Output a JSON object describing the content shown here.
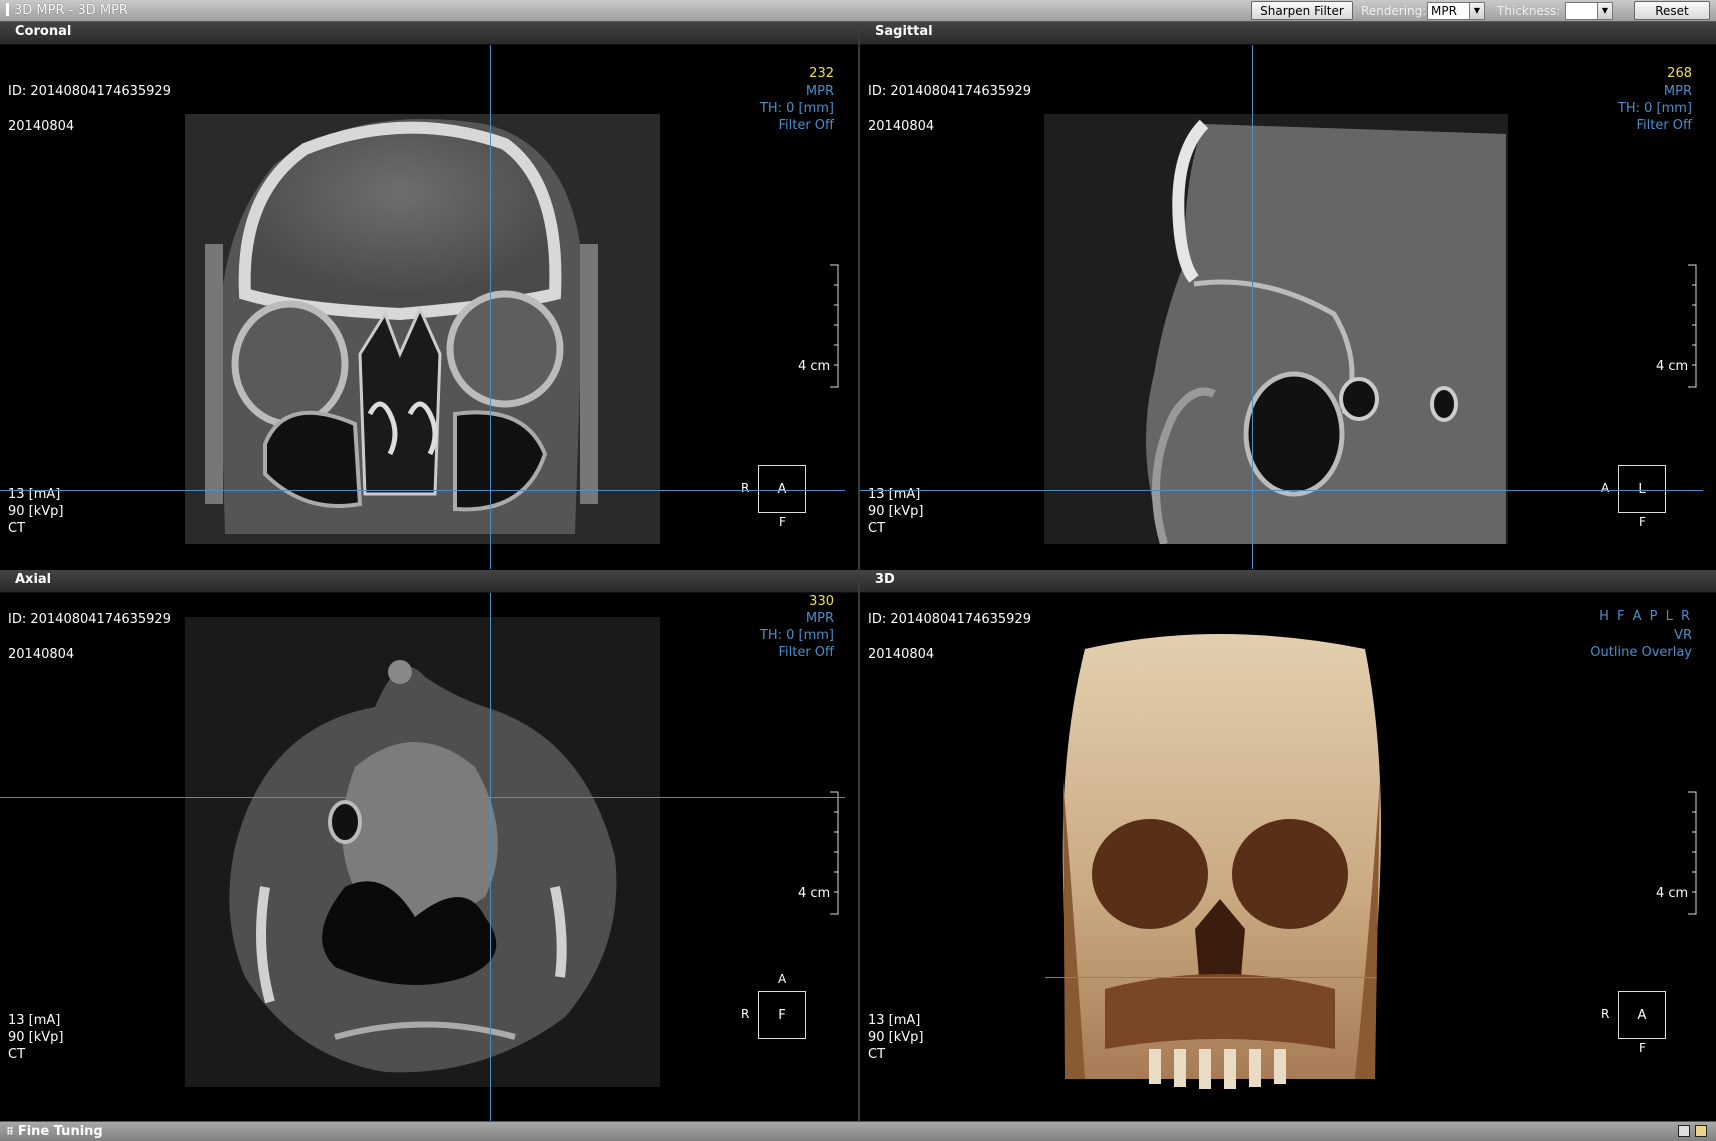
{
  "app": {
    "title": "3D MPR - 3D MPR"
  },
  "toolbar": {
    "sharpen_label": "Sharpen Filter",
    "rendering_label": "Rendering:",
    "rendering_value": "MPR",
    "thickness_label": "Thickness:",
    "thickness_value": "",
    "reset_label": "Reset"
  },
  "viewports": {
    "coronal": {
      "title": "Coronal",
      "slice": "232",
      "id": "ID: 20140804174635929",
      "date": "20140804",
      "mode": "MPR",
      "thickness": "TH: 0 [mm]",
      "filter": "Filter Off",
      "ruler_label": "4 cm",
      "ma": "13 [mA]",
      "kvp": "90 [kVp]",
      "modality": "CT",
      "orient_box": "A",
      "orient_left": "R",
      "orient_bottom": "F"
    },
    "sagittal": {
      "title": "Sagittal",
      "slice": "268",
      "id": "ID: 20140804174635929",
      "date": "20140804",
      "mode": "MPR",
      "thickness": "TH: 0 [mm]",
      "filter": "Filter Off",
      "ruler_label": "4 cm",
      "ma": "13 [mA]",
      "kvp": "90 [kVp]",
      "modality": "CT",
      "orient_box": "L",
      "orient_left": "A",
      "orient_bottom": "F"
    },
    "axial": {
      "title": "Axial",
      "slice": "330",
      "id": "ID: 20140804174635929",
      "date": "20140804",
      "mode": "MPR",
      "thickness": "TH: 0 [mm]",
      "filter": "Filter Off",
      "ruler_label": "4 cm",
      "ma": "13 [mA]",
      "kvp": "90 [kVp]",
      "modality": "CT",
      "orient_box": "F",
      "orient_left": "R",
      "orient_top": "A"
    },
    "threed": {
      "title": "3D",
      "id": "ID: 20140804174635929",
      "date": "20140804",
      "axes": "H F A P L R",
      "mode": "VR",
      "overlay": "Outline Overlay",
      "ruler_label": "4 cm",
      "ma": "13 [mA]",
      "kvp": "90 [kVp]",
      "modality": "CT",
      "orient_box": "A",
      "orient_left": "R",
      "orient_bottom": "F"
    }
  },
  "bottom": {
    "fine_tuning": "Fine Tuning"
  },
  "colors": {
    "crosshair": "#4a8fc8",
    "overlay_blue": "#4a8fc8",
    "slice_yellow": "#f2e13a"
  }
}
